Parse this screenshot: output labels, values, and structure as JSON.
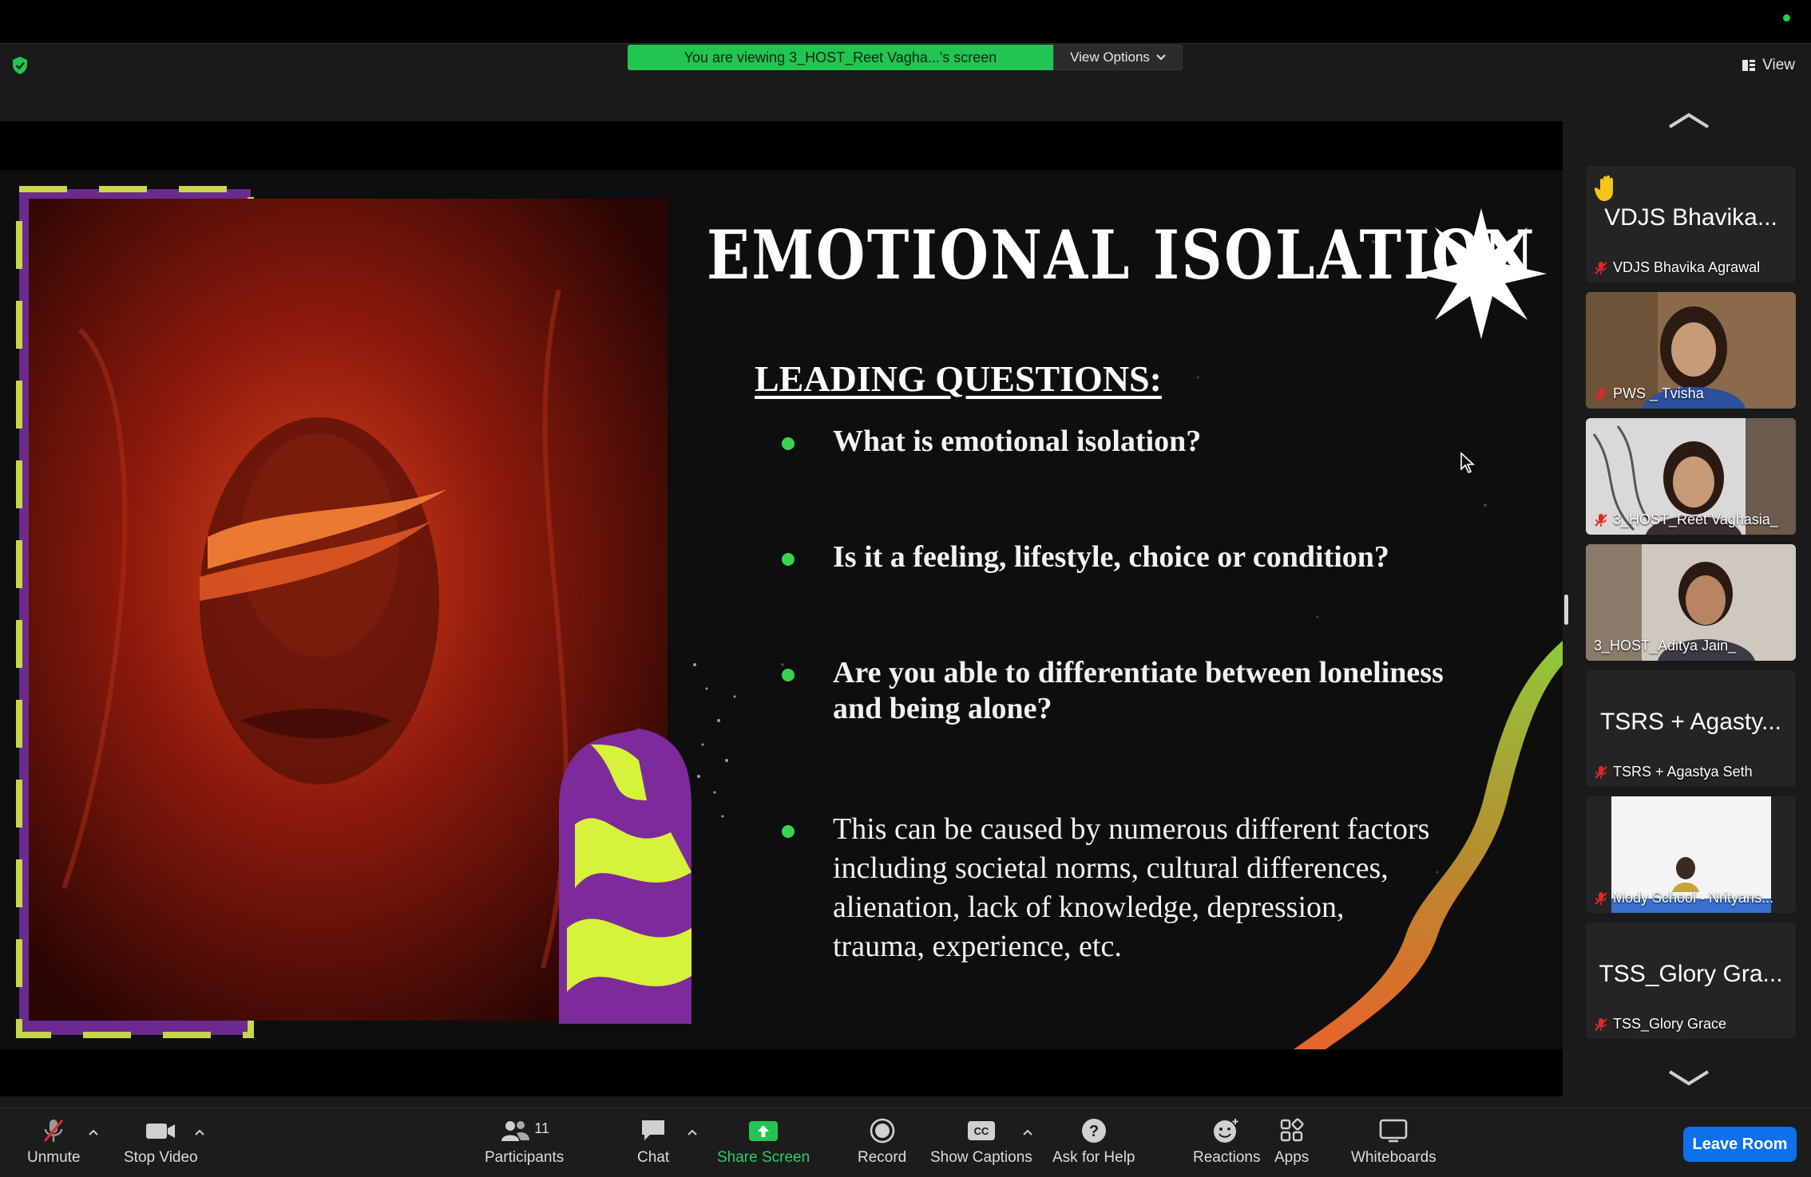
{
  "banner": {
    "viewing_text": "You are viewing 3_HOST_Reet Vagha...'s screen",
    "view_options_label": "View Options"
  },
  "header": {
    "view_label": "View"
  },
  "slide": {
    "title": "EMOTIONAL ISOLATION",
    "subheading": "LEADING QUESTIONS:",
    "bullets": [
      {
        "lines": [
          "What is emotional isolation?"
        ]
      },
      {
        "lines": [
          "Is it a feeling, lifestyle, choice or condition?"
        ]
      },
      {
        "lines": [
          "Are you able to differentiate between loneliness",
          "and being alone?"
        ]
      },
      {
        "lines": [
          "This can be caused by numerous different factors",
          "including societal norms, cultural differences,",
          "alienation, lack of knowledge, depression,",
          "trauma, experience, etc."
        ]
      }
    ]
  },
  "participants_gallery": [
    {
      "display_text": "VDJS Bhavika...",
      "name": "VDJS Bhavika Agrawal",
      "muted": true,
      "video": false,
      "hand_raised": true
    },
    {
      "display_text": "",
      "name": "PWS _ Tvisha",
      "muted": true,
      "video": true
    },
    {
      "display_text": "",
      "name": "3_HOST_Reet Vaghasia_",
      "muted": true,
      "video": true
    },
    {
      "display_text": "",
      "name": "3_HOST_Aditya Jain_",
      "muted": false,
      "video": true,
      "active_speaker": true
    },
    {
      "display_text": "TSRS + Agasty...",
      "name": "TSRS + Agastya Seth",
      "muted": true,
      "video": false
    },
    {
      "display_text": "",
      "name": "Mody School - Nrityans...",
      "muted": true,
      "video": true
    },
    {
      "display_text": "TSS_Glory Gra...",
      "name": "TSS_Glory Grace",
      "muted": true,
      "video": false
    }
  ],
  "toolbar": {
    "unmute": "Unmute",
    "stop_video": "Stop Video",
    "participants": "Participants",
    "participants_count": "11",
    "chat": "Chat",
    "share_screen": "Share Screen",
    "record": "Record",
    "show_captions": "Show Captions",
    "ask_for_help": "Ask for Help",
    "reactions": "Reactions",
    "apps": "Apps",
    "whiteboards": "Whiteboards",
    "leave_room": "Leave Room"
  },
  "colors": {
    "banner_green": "#23c552",
    "leave_blue": "#0e71eb",
    "bullet_green": "#39d353",
    "mute_red": "#e02828"
  }
}
